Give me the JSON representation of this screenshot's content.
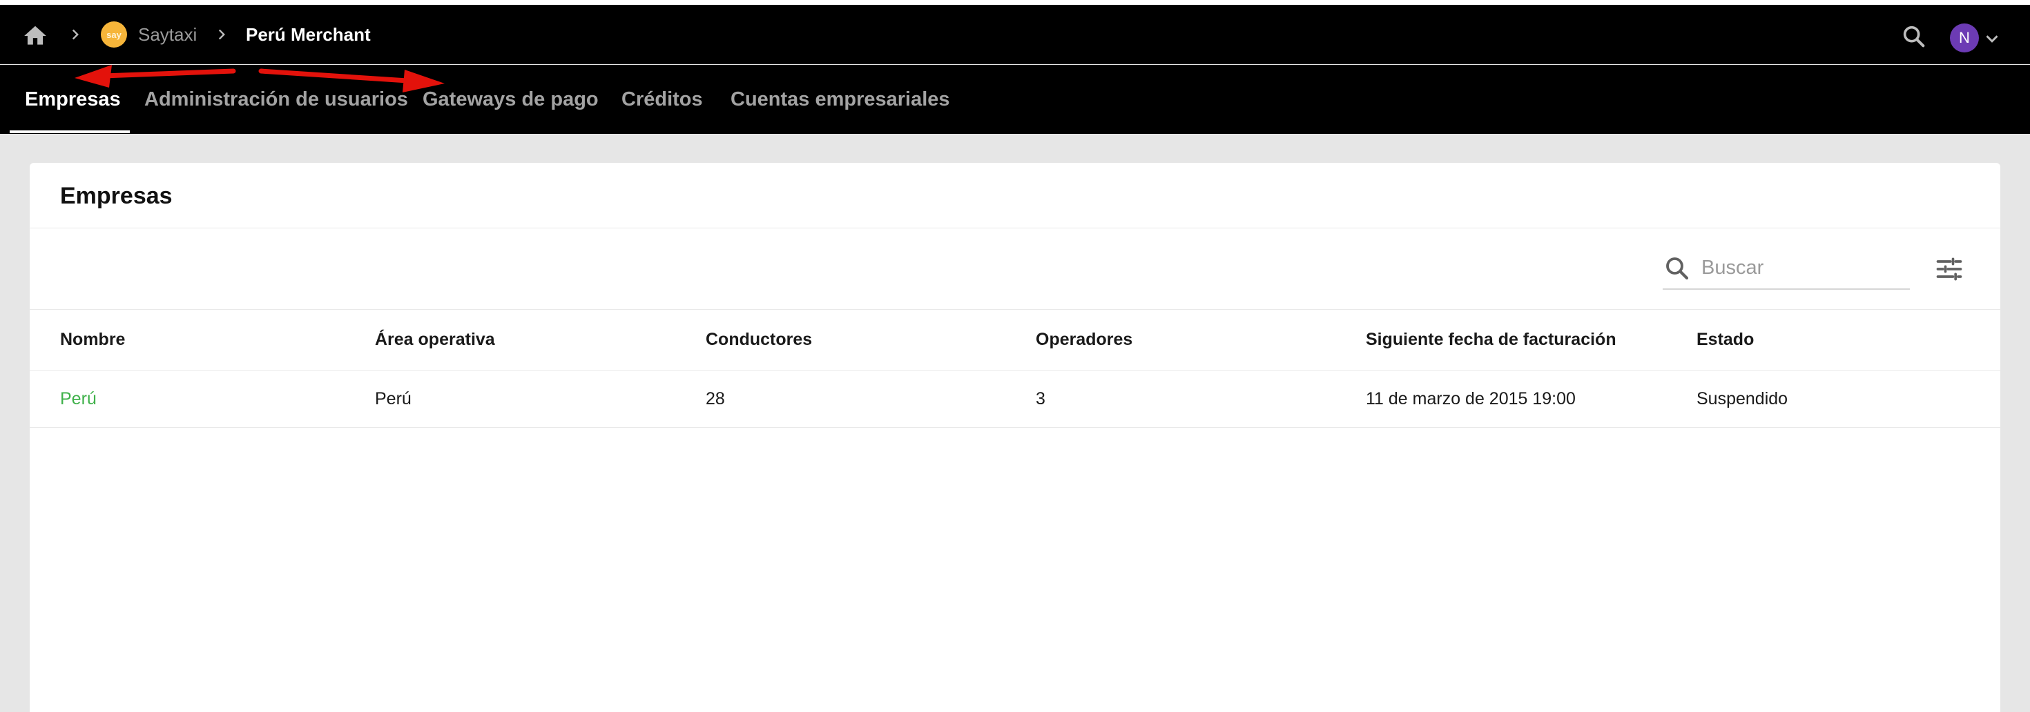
{
  "breadcrumb": {
    "home_icon": "home-icon",
    "separator_icon": "chevron-right-icon",
    "brand_logo_text": "say",
    "items": [
      "Saytaxi",
      "Perú Merchant"
    ]
  },
  "header": {
    "search_icon": "search-icon",
    "avatar_initial": "N",
    "avatar_color": "#6c3bb4",
    "caret_icon": "chevron-down-icon"
  },
  "tabs": [
    {
      "label": "Empresas",
      "active": true
    },
    {
      "label": "Administración de usuarios",
      "active": false
    },
    {
      "label": "Gateways de pago",
      "active": false
    },
    {
      "label": "Créditos",
      "active": false
    },
    {
      "label": "Cuentas empresariales",
      "active": false
    }
  ],
  "annotation": {
    "arrow_color": "#e3120b"
  },
  "card": {
    "title": "Empresas",
    "search": {
      "placeholder": "Buscar",
      "value": ""
    },
    "filter_icon": "tune-icon"
  },
  "table": {
    "columns": [
      "Nombre",
      "Área operativa",
      "Conductores",
      "Operadores",
      "Siguiente fecha de facturación",
      "Estado"
    ],
    "rows": [
      [
        "Perú",
        "Perú",
        "28",
        "3",
        "11 de marzo de 2015 19:00",
        "Suspendido"
      ]
    ]
  },
  "colors": {
    "link": "#3fb14a",
    "brand": "#f6b53a"
  }
}
